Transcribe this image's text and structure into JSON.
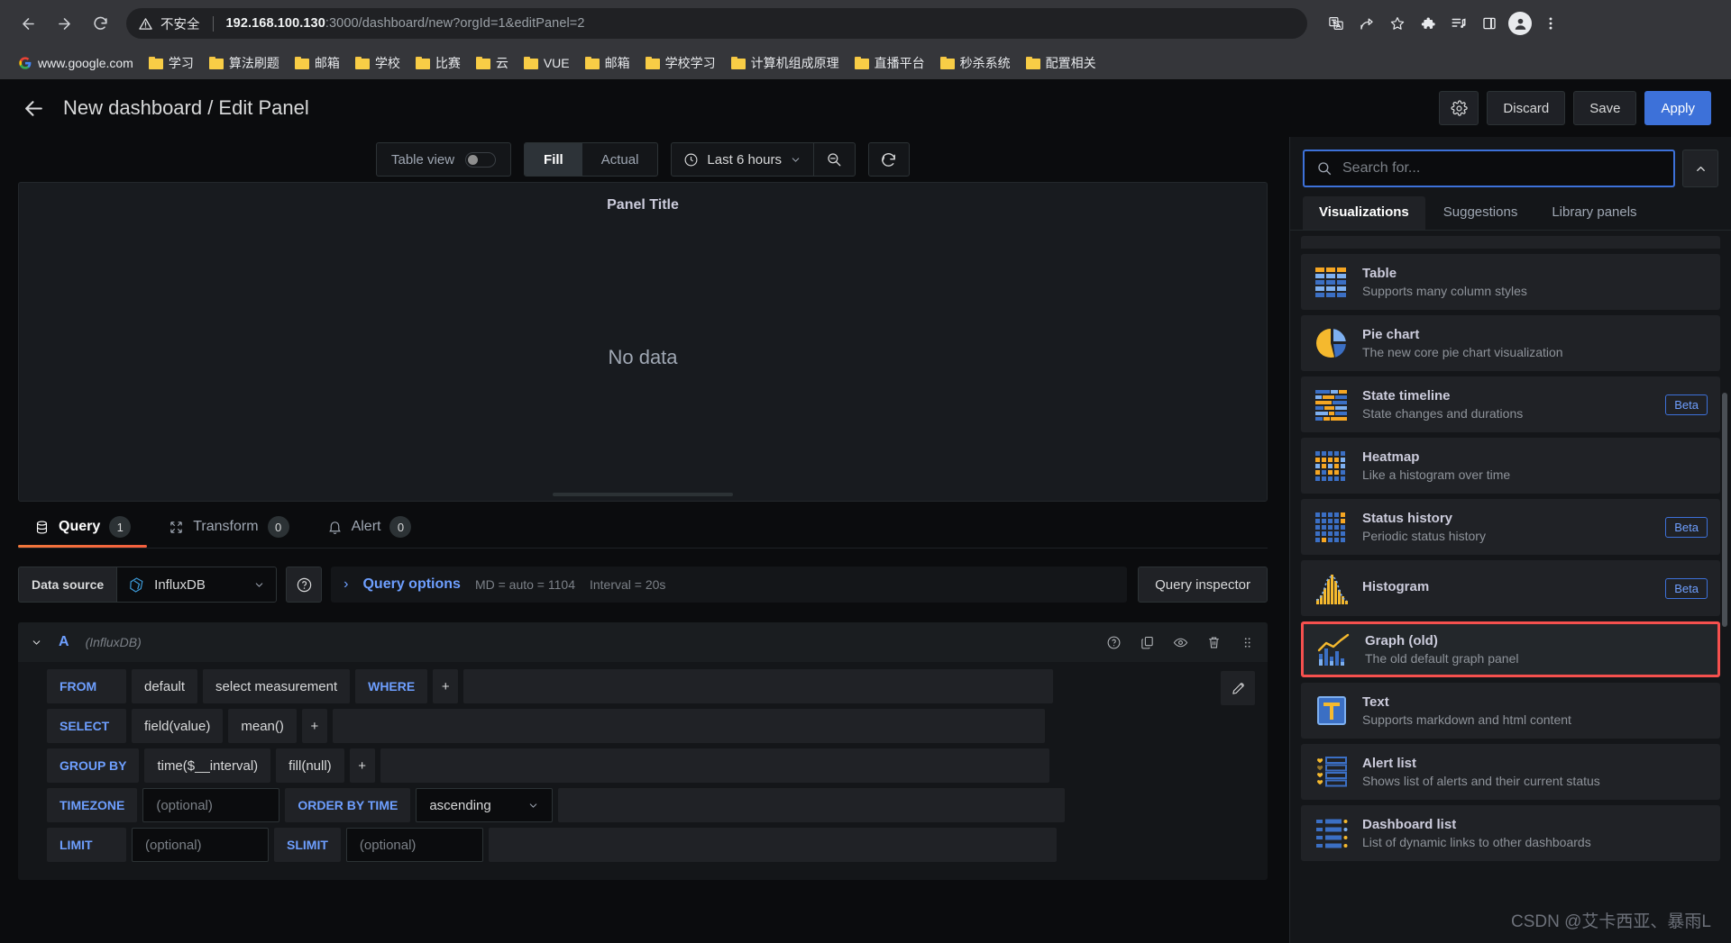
{
  "browser": {
    "security_label": "不安全",
    "url_host": "192.168.100.130",
    "url_path": ":3000/dashboard/new?orgId=1&editPanel=2",
    "bookmarks": [
      {
        "label": "www.google.com",
        "icon": "google-icon"
      },
      {
        "label": "学习",
        "icon": "folder-icon"
      },
      {
        "label": "算法刷题",
        "icon": "folder-icon"
      },
      {
        "label": "邮箱",
        "icon": "folder-icon"
      },
      {
        "label": "学校",
        "icon": "folder-icon"
      },
      {
        "label": "比赛",
        "icon": "folder-icon"
      },
      {
        "label": "云",
        "icon": "folder-icon"
      },
      {
        "label": "VUE",
        "icon": "folder-icon"
      },
      {
        "label": "邮箱",
        "icon": "folder-icon"
      },
      {
        "label": "学校学习",
        "icon": "folder-icon"
      },
      {
        "label": "计算机组成原理",
        "icon": "folder-icon"
      },
      {
        "label": "直播平台",
        "icon": "folder-icon"
      },
      {
        "label": "秒杀系统",
        "icon": "folder-icon"
      },
      {
        "label": "配置相关",
        "icon": "folder-icon"
      }
    ]
  },
  "topbar": {
    "title": "New dashboard / Edit Panel",
    "settings_label": "",
    "discard_label": "Discard",
    "save_label": "Save",
    "apply_label": "Apply"
  },
  "panel_toolbar": {
    "table_view_label": "Table view",
    "table_view_on": false,
    "fill_label": "Fill",
    "actual_label": "Actual",
    "active_fit": "Fill",
    "time_range": "Last 6 hours"
  },
  "panel": {
    "title": "Panel Title",
    "empty_text": "No data"
  },
  "query_tabs": [
    {
      "label": "Query",
      "count": "1",
      "icon": "database-icon",
      "active": true
    },
    {
      "label": "Transform",
      "count": "0",
      "icon": "transform-icon",
      "active": false
    },
    {
      "label": "Alert",
      "count": "0",
      "icon": "bell-icon",
      "active": false
    }
  ],
  "datasource_row": {
    "label": "Data source",
    "name": "InfluxDB",
    "query_options_label": "Query options",
    "max_data_points": "MD = auto = 1104",
    "interval": "Interval = 20s",
    "query_inspector_label": "Query inspector"
  },
  "query": {
    "ref_id": "A",
    "datasource_note": "(InfluxDB)",
    "rows": [
      {
        "keyword": "FROM",
        "segments": [
          "default",
          "select measurement"
        ],
        "keyword2": "WHERE",
        "plus": "+"
      },
      {
        "keyword": "SELECT",
        "segments": [
          "field(value)",
          "mean()"
        ],
        "plus": "+"
      },
      {
        "keyword": "GROUP BY",
        "segments": [
          "time($__interval)",
          "fill(null)"
        ],
        "plus": "+"
      }
    ],
    "timezone_label": "TIMEZONE",
    "timezone_value": "(optional)",
    "order_by_label": "ORDER BY TIME",
    "order_by_value": "ascending",
    "limit_label": "LIMIT",
    "limit_value": "(optional)",
    "slimit_label": "SLIMIT",
    "slimit_value": "(optional)"
  },
  "sidebar": {
    "search_placeholder": "Search for...",
    "search_value": "",
    "tabs": [
      {
        "label": "Visualizations",
        "active": true
      },
      {
        "label": "Suggestions",
        "active": false
      },
      {
        "label": "Library panels",
        "active": false
      }
    ],
    "items": [
      {
        "name": "Table",
        "desc": "Supports many column styles",
        "icon": "table-viz-icon",
        "badge": "",
        "selected": false
      },
      {
        "name": "Pie chart",
        "desc": "The new core pie chart visualization",
        "icon": "pie-viz-icon",
        "badge": "",
        "selected": false
      },
      {
        "name": "State timeline",
        "desc": "State changes and durations",
        "icon": "state-timeline-icon",
        "badge": "Beta",
        "selected": false
      },
      {
        "name": "Heatmap",
        "desc": "Like a histogram over time",
        "icon": "heatmap-icon",
        "badge": "",
        "selected": false
      },
      {
        "name": "Status history",
        "desc": "Periodic status history",
        "icon": "status-history-icon",
        "badge": "Beta",
        "selected": false
      },
      {
        "name": "Histogram",
        "desc": "",
        "icon": "histogram-icon",
        "badge": "Beta",
        "selected": false
      },
      {
        "name": "Graph (old)",
        "desc": "The old default graph panel",
        "icon": "graph-old-icon",
        "badge": "",
        "selected": true
      },
      {
        "name": "Text",
        "desc": "Supports markdown and html content",
        "icon": "text-viz-icon",
        "badge": "",
        "selected": false
      },
      {
        "name": "Alert list",
        "desc": "Shows list of alerts and their current status",
        "icon": "alert-list-icon",
        "badge": "",
        "selected": false
      },
      {
        "name": "Dashboard list",
        "desc": "List of dynamic links to other dashboards",
        "icon": "dashboard-list-icon",
        "badge": "",
        "selected": false
      }
    ]
  },
  "watermark": "CSDN @艾卡西亚、暴雨L",
  "colors": {
    "accent_blue": "#3d71d9",
    "selection_red": "#f5504e",
    "orange": "#f2783b",
    "link_blue": "#6e9fff"
  }
}
